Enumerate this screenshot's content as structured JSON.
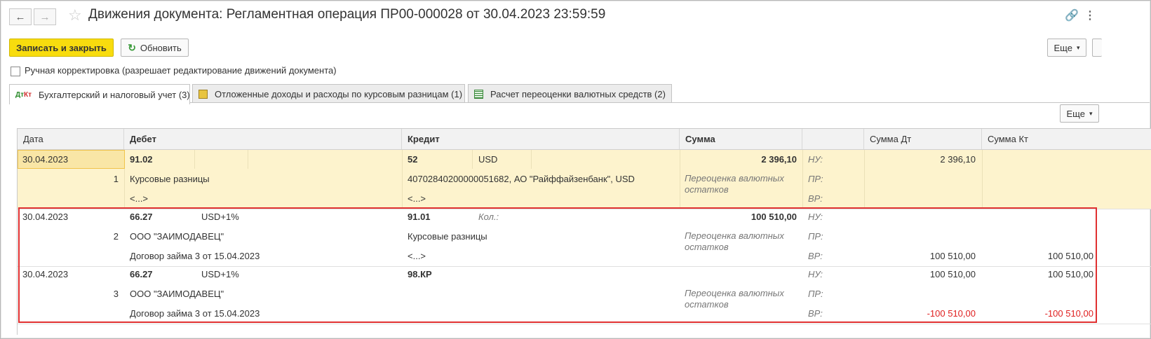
{
  "window": {
    "title": "Движения документа: Регламентная операция ПР00-000028 от 30.04.2023 23:59:59"
  },
  "toolbar": {
    "save_close": "Записать и закрыть",
    "refresh": "Обновить",
    "more": "Еще"
  },
  "manual_edit": {
    "label": "Ручная корректировка (разрешает редактирование движений документа)",
    "checked": false
  },
  "tabs": [
    {
      "label": "Бухгалтерский и налоговый учет (3)",
      "icon": "dt-kt-icon",
      "active": true
    },
    {
      "label": "Отложенные доходы и расходы по курсовым разницам (1)",
      "icon": "register-icon",
      "active": false
    },
    {
      "label": "Расчет переоценки валютных средств (2)",
      "icon": "table-icon",
      "active": false
    }
  ],
  "table_more": "Еще",
  "columns": {
    "date": "Дата",
    "debit": "Дебет",
    "credit": "Кредит",
    "sum": "Сумма",
    "sum_dt": "Сумма Дт",
    "sum_kt": "Сумма Кт"
  },
  "records": [
    {
      "date": "30.04.2023",
      "num": "1",
      "dt_account": "91.02",
      "dt_extra": "",
      "dt_sub1": "Курсовые разницы",
      "dt_sub2": "<...>",
      "dt_sub3": "",
      "kt_account": "52",
      "kt_extra": "USD",
      "kt_sub1": "40702840200000051682, АО \"Райффайзенбанк\", USD",
      "kt_sub2": "<...>",
      "kt_qty_label": "",
      "sum": "2 396,10",
      "content": "Переоценка валютных остатков",
      "lbl_nu": "НУ:",
      "lbl_pr": "ПР:",
      "lbl_vr": "ВР:",
      "nu_dt": "2 396,10",
      "nu_kt": "",
      "pr_dt": "",
      "pr_kt": "",
      "vr_dt": "",
      "vr_kt": ""
    },
    {
      "date": "30.04.2023",
      "num": "2",
      "dt_account": "66.27",
      "dt_extra": "USD+1%",
      "dt_sub1": "ООО \"ЗАИМОДАВЕЦ\"",
      "dt_sub2": "Договор займа 3 от 15.04.2023",
      "kt_account": "91.01",
      "kt_qty_label": "Кол.:",
      "kt_sub1": "Курсовые разницы",
      "kt_sub2": "<...>",
      "sum": "100 510,00",
      "content": "Переоценка валютных остатков",
      "lbl_nu": "НУ:",
      "lbl_pr": "ПР:",
      "lbl_vr": "ВР:",
      "nu_dt": "",
      "nu_kt": "",
      "pr_dt": "",
      "pr_kt": "",
      "vr_dt": "100 510,00",
      "vr_kt": "100 510,00"
    },
    {
      "date": "30.04.2023",
      "num": "3",
      "dt_account": "66.27",
      "dt_extra": "USD+1%",
      "dt_sub1": "ООО \"ЗАИМОДАВЕЦ\"",
      "dt_sub2": "Договор займа 3 от 15.04.2023",
      "kt_account": "98.КР",
      "kt_sub1": "",
      "kt_sub2": "",
      "sum": "",
      "content": "Переоценка валютных остатков",
      "lbl_nu": "НУ:",
      "lbl_pr": "ПР:",
      "lbl_vr": "ВР:",
      "nu_dt": "100 510,00",
      "nu_kt": "100 510,00",
      "pr_dt": "",
      "pr_kt": "",
      "vr_dt": "-100 510,00",
      "vr_kt": "-100 510,00"
    }
  ],
  "colors": {
    "primary_button": "#f8dc0e",
    "selected_row": "#fdf3cd",
    "highlight_frame": "#e03030",
    "negative": "#e02020"
  }
}
